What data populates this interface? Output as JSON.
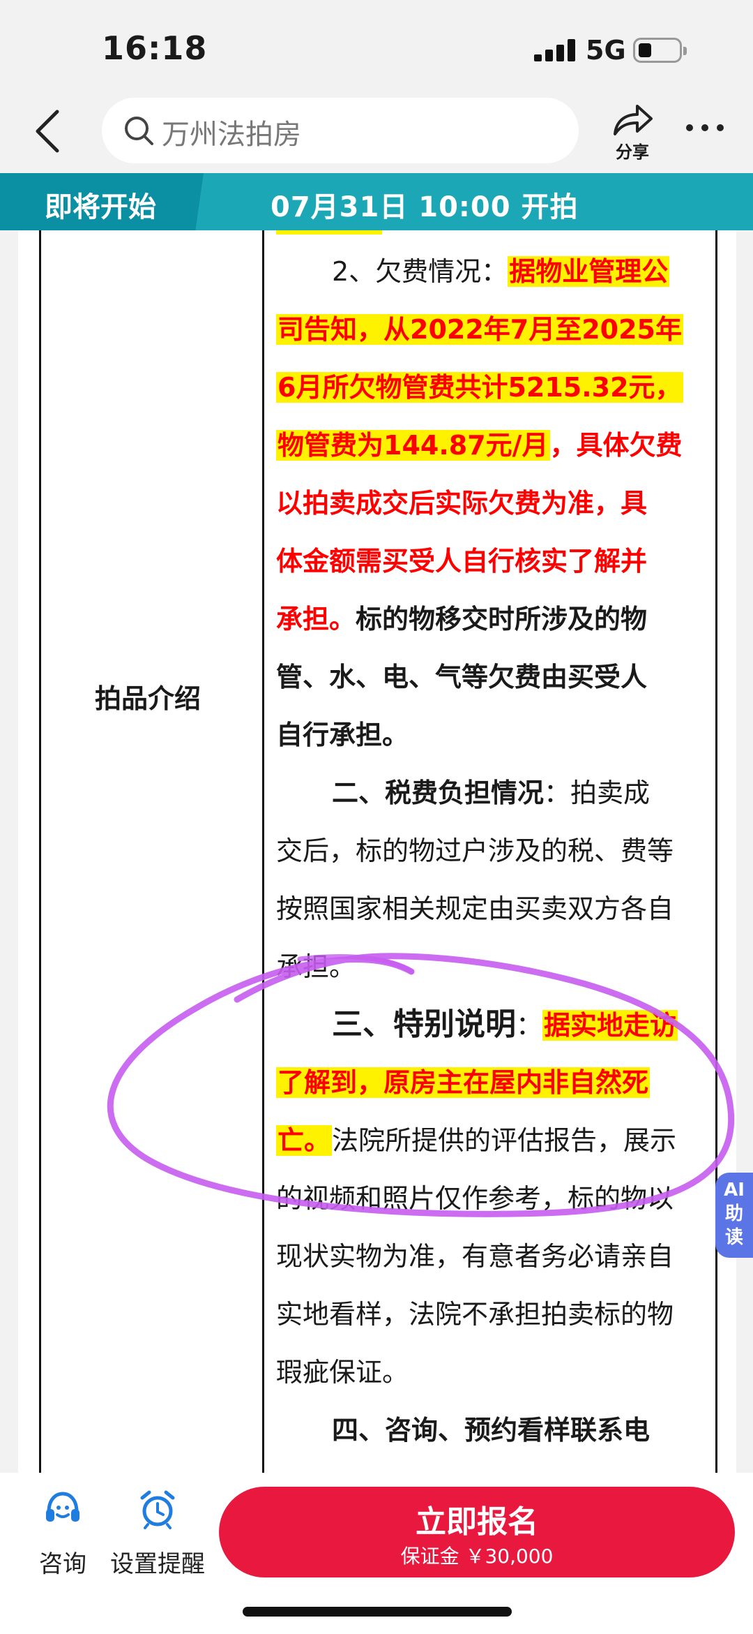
{
  "status_bar": {
    "time": "16:18",
    "network": "5G"
  },
  "nav": {
    "search_text": "万州法拍房",
    "share_label": "分享"
  },
  "banner": {
    "status": "即将开始",
    "start_time": "07月31日 10:00 开拍"
  },
  "document": {
    "row_label": "拍品介绍",
    "lines": {
      "l1_prefix": "2、欠费情况：",
      "l1_hl": "据物业管理公",
      "l2_hl": "司告知，从2022年7月至2025年",
      "l3_hl": "6月所欠物管费共计5215.32元，",
      "l4_hl": "物管费为144.87元/月",
      "l4_red": "，具体欠费",
      "l5_red": "以拍卖成交后实际欠费为准，具",
      "l6_red": "体金额需买受人自行核实了解并",
      "l7_red": "承担。",
      "l7_rest": "标的物移交时所涉及的物",
      "l8": "管、水、电、气等欠费由买受人",
      "l9": "自行承担。",
      "l10_bold": "二、税费负担情况",
      "l10_rest": "：拍卖成",
      "l11": "交后，标的物过户涉及的税、费等",
      "l12": "按照国家相关规定由买卖双方各自",
      "l13": "承担。",
      "l14_bold": "三、特别说明",
      "l14_colon": "：",
      "l14_hl": "据实地走访",
      "l15_hl": "了解到，原房主在屋内非自然死",
      "l16_hl": "亡。",
      "l16_rest": "法院所提供的评估报告，展示",
      "l17": "的视频和照片仅作参考，标的物以",
      "l18": "现状实物为准，有意者务必请亲自",
      "l19": "实地看样，法院不承担拍卖标的物",
      "l20": "瑕疵保证。",
      "l21": "四、咨询、预约看样联系电"
    }
  },
  "ai_badge": {
    "ai": "AI",
    "c1": "助",
    "c2": "读"
  },
  "bottom": {
    "consult_label": "咨询",
    "reminder_label": "设置提醒",
    "signup_label": "立即报名",
    "deposit_text": "保证金 ￥30,000"
  },
  "colors": {
    "accent": "#e8183e",
    "banner": "#1ba7b5",
    "highlight": "#fff200",
    "annotation": "#c65cf0"
  }
}
